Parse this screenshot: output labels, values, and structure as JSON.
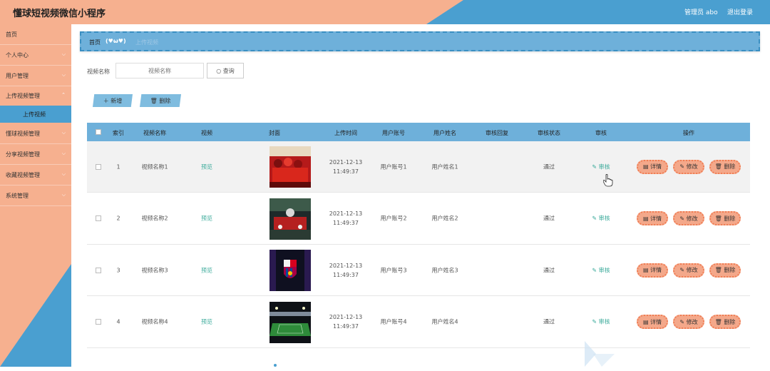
{
  "header": {
    "title": "懂球短视频微信小程序",
    "admin_label": "管理员 abo",
    "logout_label": "退出登录"
  },
  "sidebar": {
    "items": [
      {
        "label": "首页"
      },
      {
        "label": "个人中心"
      },
      {
        "label": "用户管理"
      },
      {
        "label": "上传视频管理"
      },
      {
        "label": "上传视频"
      },
      {
        "label": "懂球视频管理"
      },
      {
        "label": "分享视频管理"
      },
      {
        "label": "收藏视频管理"
      },
      {
        "label": "系统管理"
      }
    ]
  },
  "breadcrumb": {
    "home": "首页",
    "emoji": "(♥ω♥)",
    "current": "上传视频"
  },
  "search": {
    "label": "视频名称",
    "placeholder": "视频名称",
    "button": "查询"
  },
  "actions": {
    "add": "＋ 新增",
    "delete": "删除"
  },
  "table": {
    "columns": [
      "索引",
      "视频名称",
      "视频",
      "封面",
      "上传时间",
      "用户账号",
      "用户姓名",
      "审核回复",
      "审核状态",
      "审核",
      "操作"
    ],
    "rows": [
      {
        "index": "1",
        "name": "视频名称1",
        "video": "预览",
        "cover": "red-team-photo",
        "time": "2021-12-13 11:49:37",
        "account": "用户账号1",
        "username": "用户姓名1",
        "reply": "",
        "status": "通过",
        "review": "审核"
      },
      {
        "index": "2",
        "name": "视频名称2",
        "video": "预览",
        "cover": "trophy-celebration-photo",
        "time": "2021-12-13 11:49:37",
        "account": "用户账号2",
        "username": "用户姓名2",
        "reply": "",
        "status": "通过",
        "review": "审核"
      },
      {
        "index": "3",
        "name": "视频名称3",
        "video": "预览",
        "cover": "barcelona-crest",
        "time": "2021-12-13 11:49:37",
        "account": "用户账号3",
        "username": "用户姓名3",
        "reply": "",
        "status": "通过",
        "review": "审核"
      },
      {
        "index": "4",
        "name": "视频名称4",
        "video": "预览",
        "cover": "stadium-photo",
        "time": "2021-12-13 11:49:37",
        "account": "用户账号4",
        "username": "用户姓名4",
        "reply": "",
        "status": "通过",
        "review": "审核"
      }
    ],
    "row_actions": {
      "detail": "详情",
      "edit": "修改",
      "delete": "删除"
    }
  },
  "colors": {
    "salmon": "#f6b08f",
    "blue": "#4a9fd0",
    "table_header": "#6eb0da",
    "op_button": "#f4a88a",
    "link_green": "#3aaa9a"
  }
}
